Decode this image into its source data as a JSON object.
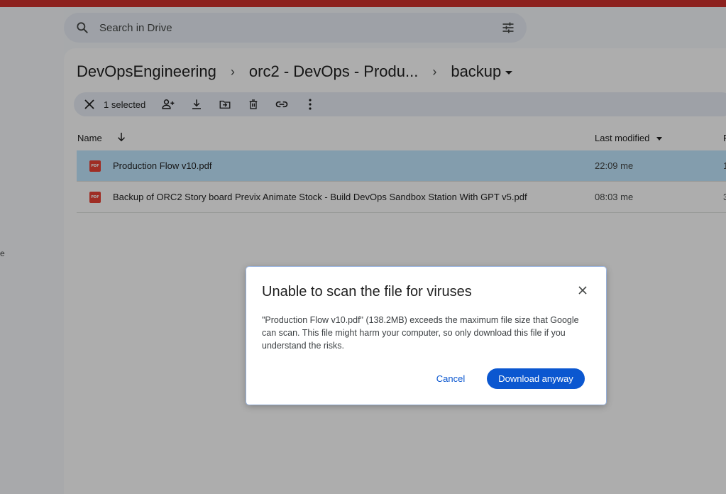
{
  "left_rail": {
    "partial_text": "e"
  },
  "search": {
    "placeholder": "Search in Drive"
  },
  "breadcrumb": {
    "items": [
      "DevOpsEngineering",
      "orc2 - DevOps - Produ..."
    ],
    "current": "backup"
  },
  "selection_bar": {
    "count_label": "1 selected"
  },
  "columns": {
    "name": "Name",
    "last_modified": "Last modified",
    "owner_partial": "F"
  },
  "files": [
    {
      "name": "Production Flow  v10.pdf",
      "modified": "22:09 me",
      "owner_partial": "1",
      "selected": true,
      "type": "pdf"
    },
    {
      "name": "Backup of ORC2  Story board Previx  Animate  Stock - Build DevOps Sandbox Station  With GPT v5.pdf",
      "modified": "08:03 me",
      "owner_partial": "3",
      "selected": false,
      "type": "pdf"
    }
  ],
  "dialog": {
    "title": "Unable to scan the file for viruses",
    "body": "\"Production Flow v10.pdf\" (138.2MB) exceeds the maximum file size that Google can scan. This file might harm your computer, so only download this file if you understand the risks.",
    "cancel_label": "Cancel",
    "download_label": "Download anyway"
  },
  "colors": {
    "accent": "#0b57d0",
    "selected_row": "#c2e7ff",
    "top_bar": "#d0312d",
    "pdf_icon": "#ea4335"
  },
  "icons": [
    "search-icon",
    "filter-icon",
    "close-icon",
    "share-icon",
    "download-icon",
    "move-icon",
    "delete-icon",
    "link-icon",
    "more-icon",
    "sort-arrow-icon",
    "pdf-icon"
  ]
}
